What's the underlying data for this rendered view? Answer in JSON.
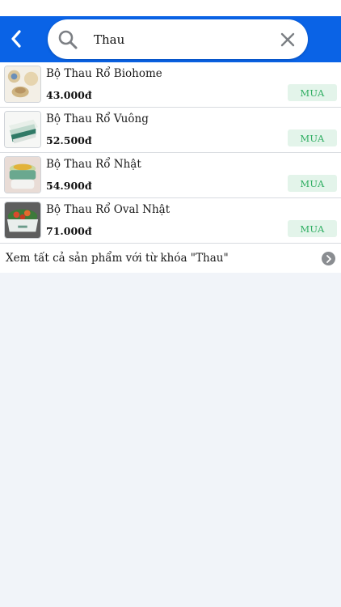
{
  "search": {
    "value": "Thau",
    "placeholder": ""
  },
  "results": [
    {
      "name": "Bộ Thau Rổ Biohome",
      "price": "43.000đ",
      "buy_label": "MUA"
    },
    {
      "name": "Bộ Thau Rổ Vuông",
      "price": "52.500đ",
      "buy_label": "MUA"
    },
    {
      "name": "Bộ Thau Rổ Nhật",
      "price": "54.900đ",
      "buy_label": "MUA"
    },
    {
      "name": "Bộ Thau Rổ Oval Nhật",
      "price": "71.000đ",
      "buy_label": "MUA"
    }
  ],
  "view_all": {
    "label": "Xem tất cả sản phẩm với từ khóa \"Thau\""
  },
  "icons": {
    "back": "chevron-left-icon",
    "search": "search-icon",
    "clear": "close-icon",
    "view_all": "chevron-right-circle-icon"
  },
  "colors": {
    "header": "#0a63e6",
    "buy_bg": "#e3f4ea",
    "buy_text": "#2fae62",
    "background": "#f1f4f9"
  }
}
